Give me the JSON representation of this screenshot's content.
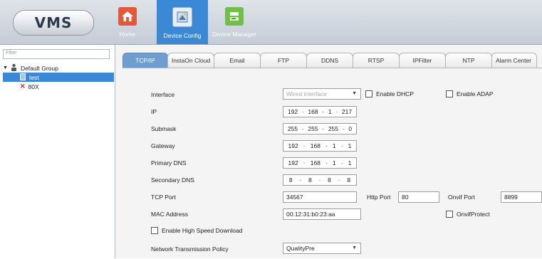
{
  "app": {
    "title": "VMS"
  },
  "nav": [
    {
      "label": "Home",
      "icon": "home-icon"
    },
    {
      "label": "Device Config",
      "icon": "device-config-icon"
    },
    {
      "label": "Device Manager",
      "icon": "device-manager-icon"
    }
  ],
  "sidebar": {
    "filter_placeholder": "Filter",
    "group": "Default Group",
    "devices": [
      "test",
      "80X"
    ]
  },
  "tabs": [
    "TCP/IP",
    "InstaOn Cloud",
    "Email",
    "FTP",
    "DDNS",
    "RTSP",
    "IPFilter",
    "NTP",
    "Alarm Center"
  ],
  "form": {
    "interface_label": "Interface",
    "interface_value": "Wired interface",
    "enable_dhcp": "Enable DHCP",
    "enable_adap": "Enable ADAP",
    "ip_label": "IP",
    "ip": [
      "192",
      "168",
      "1",
      "217"
    ],
    "submask_label": "Submask",
    "submask": [
      "255",
      "255",
      "255",
      "0"
    ],
    "gateway_label": "Gateway",
    "gateway": [
      "192",
      "168",
      "1",
      "1"
    ],
    "primary_dns_label": "Primary DNS",
    "primary_dns": [
      "192",
      "168",
      "1",
      "1"
    ],
    "secondary_dns_label": "Secondary DNS",
    "secondary_dns": [
      "8",
      "8",
      "8",
      "8"
    ],
    "tcp_port_label": "TCP Port",
    "tcp_port": "34567",
    "http_port_label": "Http Port",
    "http_port": "80",
    "onvif_port_label": "Onvif Port",
    "onvif_port": "8899",
    "mac_label": "MAC Address",
    "mac": "00:12:31:b0:23:aa",
    "onvif_protect": "OnvifProtect",
    "high_speed": "Enable High Speed Download",
    "policy_label": "Network Transmission Policy",
    "policy_value": "QualityPre"
  },
  "colors": {
    "accent": "#3b89d6",
    "active_tab": "#6e9ed0"
  }
}
